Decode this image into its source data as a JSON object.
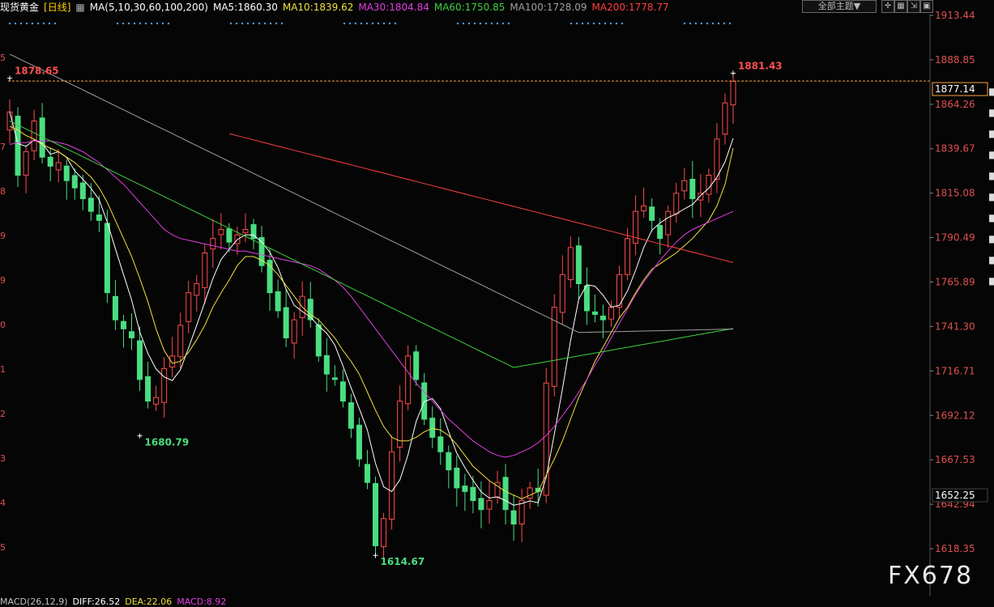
{
  "header": {
    "instrument": "现货黄金",
    "period": "[日线]",
    "ma_label": "MA(5,10,30,60,100,200)",
    "ma_values": [
      {
        "text": "MA5:1860.30",
        "color": "#ffffff"
      },
      {
        "text": "MA10:1839.62",
        "color": "#f0e040"
      },
      {
        "text": "MA30:1804.84",
        "color": "#e040e0"
      },
      {
        "text": "MA60:1750.85",
        "color": "#40d040"
      },
      {
        "text": "MA100:1728.09",
        "color": "#a0a0a0"
      },
      {
        "text": "MA200:1778.77",
        "color": "#ff4040"
      }
    ],
    "theme_select": "全部主题▼"
  },
  "indicator_bar": {
    "items": [
      {
        "text": "MACD(26,12,9)",
        "color": "#c0c0c0"
      },
      {
        "text": "DIFF:26.52",
        "color": "#ffffff"
      },
      {
        "text": "DEA:22.06",
        "color": "#f0e040"
      },
      {
        "text": "MACD:8.92",
        "color": "#e040e0"
      }
    ]
  },
  "watermark": "FX678",
  "chart_data": {
    "type": "candlestick",
    "y_axis": {
      "ticks": [
        1913.44,
        1888.85,
        1864.26,
        1839.67,
        1815.08,
        1790.49,
        1765.89,
        1741.3,
        1716.71,
        1692.12,
        1667.53,
        1642.94,
        1618.35
      ],
      "range": [
        1600,
        1920
      ]
    },
    "current_price": 1877.14,
    "side_label": 1652.25,
    "annotations": [
      {
        "text": "1878.65",
        "value": 1878.65,
        "index": 0
      },
      {
        "text": "1881.43",
        "value": 1881.43,
        "index": 89
      },
      {
        "text": "1680.79",
        "value": 1680.79,
        "index": 16
      },
      {
        "text": "1614.67",
        "value": 1614.67,
        "index": 45
      }
    ],
    "legend": {
      "MA5": "#ffffff",
      "MA10": "#f0e040",
      "MA30": "#e040e0",
      "MA60": "#40d040",
      "MA100": "#a0a0a0",
      "MA200": "#ff4040"
    },
    "closes": [
      1860,
      1825,
      1838,
      1855,
      1835,
      1830,
      1832,
      1822,
      1818,
      1812,
      1805,
      1800,
      1760,
      1745,
      1740,
      1735,
      1712,
      1700,
      1702,
      1718,
      1725,
      1742,
      1760,
      1765,
      1782,
      1790,
      1795,
      1788,
      1792,
      1795,
      1790,
      1775,
      1760,
      1750,
      1735,
      1745,
      1758,
      1745,
      1725,
      1715,
      1712,
      1700,
      1685,
      1668,
      1655,
      1620,
      1635,
      1672,
      1700,
      1725,
      1712,
      1690,
      1680,
      1672,
      1662,
      1652,
      1650,
      1645,
      1640,
      1645,
      1655,
      1640,
      1632,
      1645,
      1652,
      1650,
      1710,
      1752,
      1770,
      1785,
      1765,
      1750,
      1748,
      1745,
      1752,
      1770,
      1790,
      1805,
      1808,
      1800,
      1790,
      1805,
      1815,
      1822,
      1812,
      1815,
      1825,
      1845,
      1865,
      1877
    ],
    "ma10": [
      1852,
      1850,
      1847,
      1845,
      1842,
      1840,
      1838,
      1835,
      1832,
      1828,
      1824,
      1818,
      1810,
      1800,
      1790,
      1780,
      1768,
      1755,
      1740,
      1728,
      1721,
      1722,
      1727,
      1734,
      1742,
      1752,
      1760,
      1767,
      1775,
      1780,
      1780,
      1778,
      1775,
      1770,
      1764,
      1758,
      1752,
      1748,
      1745,
      1740,
      1735,
      1728,
      1722,
      1715,
      1705,
      1695,
      1686,
      1680,
      1678,
      1678,
      1680,
      1683,
      1685,
      1684,
      1681,
      1676,
      1670,
      1664,
      1660,
      1656,
      1653,
      1650,
      1648,
      1646,
      1648,
      1650,
      1659,
      1668,
      1678,
      1690,
      1702,
      1712,
      1722,
      1730,
      1738,
      1746,
      1752,
      1760,
      1767,
      1773,
      1776,
      1779,
      1782,
      1786,
      1790,
      1795,
      1800,
      1808,
      1820,
      1840
    ],
    "ma30": [
      1842,
      1843,
      1843,
      1844,
      1844,
      1844,
      1843,
      1842,
      1840,
      1838,
      1835,
      1832,
      1828,
      1824,
      1820,
      1815,
      1810,
      1805,
      1800,
      1795,
      1792,
      1790,
      1789,
      1788,
      1787,
      1786,
      1785,
      1784,
      1783,
      1783,
      1782,
      1781,
      1780,
      1779,
      1778,
      1777,
      1776,
      1775,
      1773,
      1770,
      1767,
      1763,
      1758,
      1752,
      1746,
      1740,
      1734,
      1728,
      1722,
      1716,
      1710,
      1705,
      1700,
      1695,
      1690,
      1686,
      1682,
      1678,
      1675,
      1672,
      1670,
      1669,
      1670,
      1672,
      1674,
      1677,
      1681,
      1686,
      1692,
      1698,
      1705,
      1712,
      1720,
      1727,
      1735,
      1743,
      1751,
      1759,
      1766,
      1772,
      1778,
      1783,
      1788,
      1792,
      1795,
      1797,
      1799,
      1801,
      1803,
      1805
    ]
  }
}
